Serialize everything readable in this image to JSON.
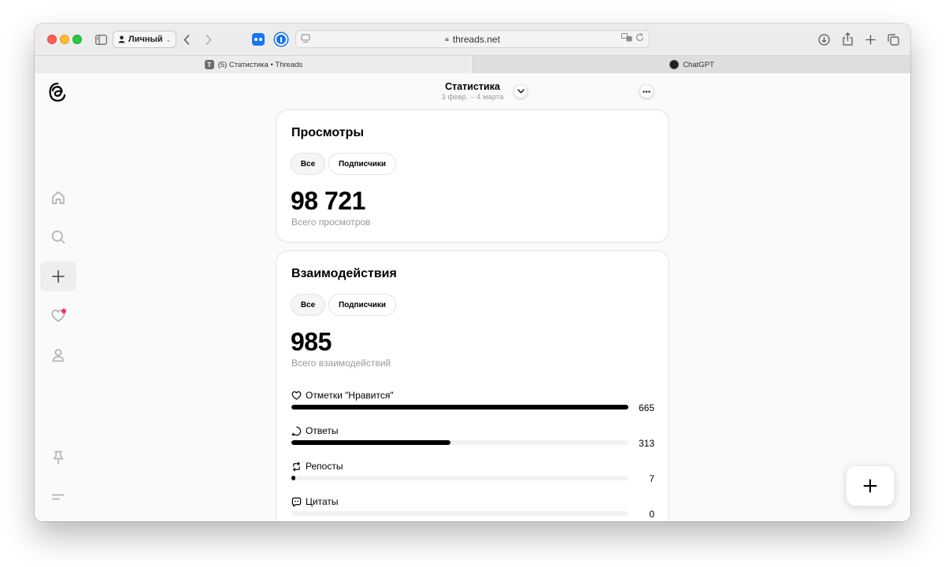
{
  "browser": {
    "profile_label": "Личный",
    "url": "threads.net",
    "tabs": [
      {
        "label": "(5) Статистика • Threads",
        "favicon_letter": "T",
        "active": true
      },
      {
        "label": "ChatGPT",
        "active": false
      }
    ]
  },
  "header": {
    "title": "Статистика",
    "date_range": "3 февр. – 4 марта"
  },
  "views_card": {
    "title": "Просмотры",
    "filter_all": "Все",
    "filter_followers": "Подписчики",
    "total": "98 721",
    "total_label": "Всего просмотров"
  },
  "interactions_card": {
    "title": "Взаимодействия",
    "filter_all": "Все",
    "filter_followers": "Подписчики",
    "total": "985",
    "total_label": "Всего взаимодействий",
    "metrics": [
      {
        "label": "Отметки \"Нравится\"",
        "value": "665",
        "fraction": 1.0
      },
      {
        "label": "Ответы",
        "value": "313",
        "fraction": 0.471
      },
      {
        "label": "Репосты",
        "value": "7",
        "fraction": 0.0105
      },
      {
        "label": "Цитаты",
        "value": "0",
        "fraction": 0
      }
    ]
  },
  "colors": {
    "bar_fill": "#000000",
    "bar_track": "#f2f2f2",
    "notification_dot": "#ff3040",
    "muted_text": "#999999"
  }
}
